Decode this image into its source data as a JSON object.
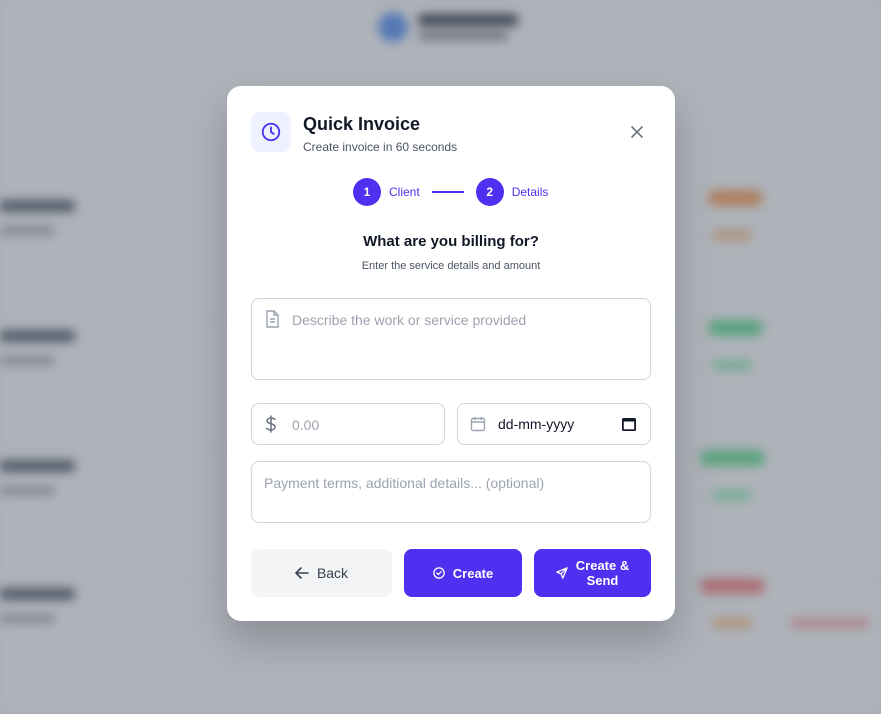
{
  "modal": {
    "title": "Quick Invoice",
    "subtitle": "Create invoice in 60 seconds",
    "icon": "clock-icon",
    "close_icon": "close-icon"
  },
  "stepper": {
    "steps": [
      {
        "number": "1",
        "label": "Client"
      },
      {
        "number": "2",
        "label": "Details"
      }
    ],
    "active_color": "#4f2ff0"
  },
  "section": {
    "title": "What are you billing for?",
    "subtitle": "Enter the service details and amount"
  },
  "form": {
    "description_placeholder": "Describe the work or service provided",
    "amount_placeholder": "0.00",
    "date_placeholder": "dd-mm-yyyy",
    "notes_placeholder": "Payment terms, additional details... (optional)"
  },
  "buttons": {
    "back": "Back",
    "create": "Create",
    "create_send": "Create & Send"
  },
  "colors": {
    "accent": "#4f2ff0",
    "overlay": "#6b7280"
  }
}
